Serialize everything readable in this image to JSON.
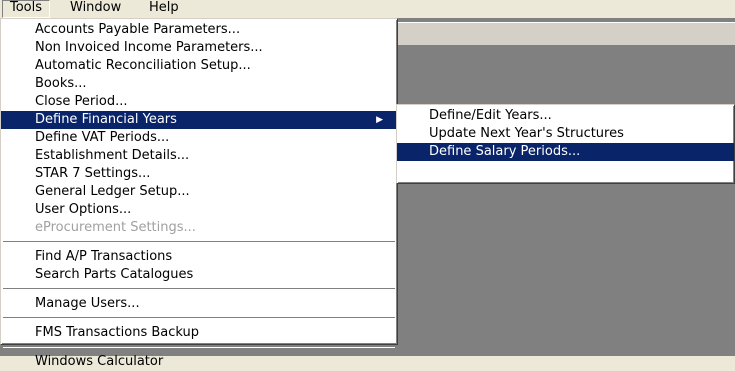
{
  "menubar": {
    "tools": "Tools",
    "window": "Window",
    "help": "Help"
  },
  "tools_menu": {
    "items": [
      "Accounts Payable Parameters...",
      "Non Invoiced Income Parameters...",
      "Automatic Reconciliation Setup...",
      "Books...",
      "Close Period...",
      "Define Financial Years",
      "Define VAT Periods...",
      "Establishment Details...",
      "STAR 7 Settings...",
      "General Ledger Setup...",
      "User Options...",
      "eProcurement Settings...",
      "Find A/P Transactions",
      "Search Parts Catalogues",
      "Manage Users...",
      "FMS Transactions Backup",
      "Windows Calculator"
    ],
    "submenu_arrow_icon": "triangle-right-icon"
  },
  "submenu": {
    "items": [
      "Define/Edit Years...",
      "Update Next Year's Structures",
      "Define Salary Periods..."
    ]
  },
  "colors": {
    "highlight": "#0a246a",
    "workspace": "#808080",
    "menu_background": "#ffffff"
  }
}
